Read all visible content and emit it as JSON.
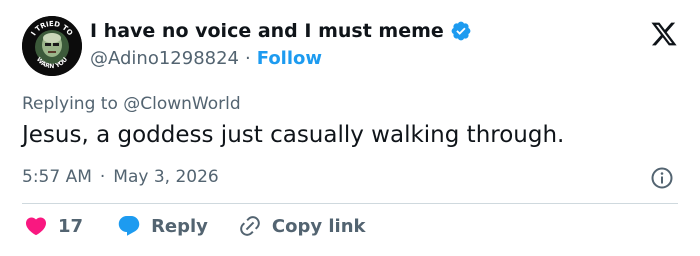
{
  "author": {
    "display_name": "I have no voice and I must meme",
    "handle": "@Adino1298824",
    "separator": "·",
    "follow_label": "Follow",
    "avatar_text_top": "I TRIED TO",
    "avatar_text_bottom": "WARN YOU"
  },
  "reply_context": {
    "label": "Replying to @ClownWorld"
  },
  "tweet": {
    "text": "Jesus, a goddess just casually walking through."
  },
  "meta": {
    "time": "5:57 AM",
    "separator": "·",
    "date": "May 3, 2026"
  },
  "actions": {
    "like_count": "17",
    "reply_label": "Reply",
    "copy_label": "Copy link"
  },
  "colors": {
    "accent": "#1d9bf0",
    "like": "#f91880",
    "text_secondary": "#536471",
    "text_primary": "#0f1419"
  }
}
